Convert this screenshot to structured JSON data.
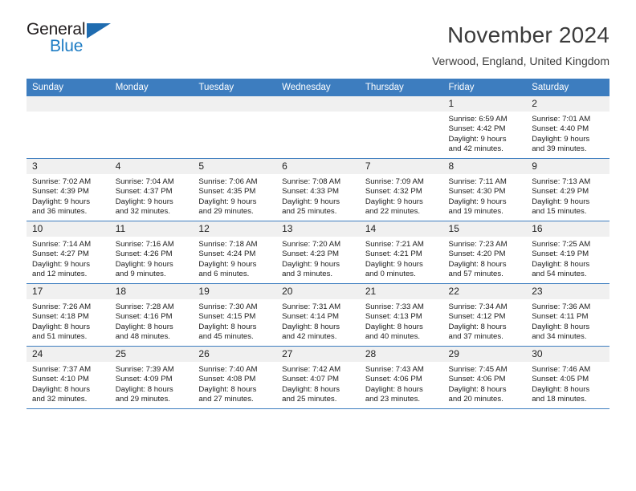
{
  "brand": {
    "name_top": "General",
    "name_bottom": "Blue",
    "triangle_icon": "triangle-icon",
    "accent_color": "#1f6cb0"
  },
  "header": {
    "title": "November 2024",
    "subtitle": "Verwood, England, United Kingdom"
  },
  "calendar": {
    "header_bg": "#3d7dbf",
    "daynum_bg": "#f0f0f0",
    "weekday_headers": [
      "Sunday",
      "Monday",
      "Tuesday",
      "Wednesday",
      "Thursday",
      "Friday",
      "Saturday"
    ],
    "weeks": [
      [
        {
          "day": "",
          "sunrise": "",
          "sunset": "",
          "daylight_line1": "",
          "daylight_line2": ""
        },
        {
          "day": "",
          "sunrise": "",
          "sunset": "",
          "daylight_line1": "",
          "daylight_line2": ""
        },
        {
          "day": "",
          "sunrise": "",
          "sunset": "",
          "daylight_line1": "",
          "daylight_line2": ""
        },
        {
          "day": "",
          "sunrise": "",
          "sunset": "",
          "daylight_line1": "",
          "daylight_line2": ""
        },
        {
          "day": "",
          "sunrise": "",
          "sunset": "",
          "daylight_line1": "",
          "daylight_line2": ""
        },
        {
          "day": "1",
          "sunrise": "Sunrise: 6:59 AM",
          "sunset": "Sunset: 4:42 PM",
          "daylight_line1": "Daylight: 9 hours",
          "daylight_line2": "and 42 minutes."
        },
        {
          "day": "2",
          "sunrise": "Sunrise: 7:01 AM",
          "sunset": "Sunset: 4:40 PM",
          "daylight_line1": "Daylight: 9 hours",
          "daylight_line2": "and 39 minutes."
        }
      ],
      [
        {
          "day": "3",
          "sunrise": "Sunrise: 7:02 AM",
          "sunset": "Sunset: 4:39 PM",
          "daylight_line1": "Daylight: 9 hours",
          "daylight_line2": "and 36 minutes."
        },
        {
          "day": "4",
          "sunrise": "Sunrise: 7:04 AM",
          "sunset": "Sunset: 4:37 PM",
          "daylight_line1": "Daylight: 9 hours",
          "daylight_line2": "and 32 minutes."
        },
        {
          "day": "5",
          "sunrise": "Sunrise: 7:06 AM",
          "sunset": "Sunset: 4:35 PM",
          "daylight_line1": "Daylight: 9 hours",
          "daylight_line2": "and 29 minutes."
        },
        {
          "day": "6",
          "sunrise": "Sunrise: 7:08 AM",
          "sunset": "Sunset: 4:33 PM",
          "daylight_line1": "Daylight: 9 hours",
          "daylight_line2": "and 25 minutes."
        },
        {
          "day": "7",
          "sunrise": "Sunrise: 7:09 AM",
          "sunset": "Sunset: 4:32 PM",
          "daylight_line1": "Daylight: 9 hours",
          "daylight_line2": "and 22 minutes."
        },
        {
          "day": "8",
          "sunrise": "Sunrise: 7:11 AM",
          "sunset": "Sunset: 4:30 PM",
          "daylight_line1": "Daylight: 9 hours",
          "daylight_line2": "and 19 minutes."
        },
        {
          "day": "9",
          "sunrise": "Sunrise: 7:13 AM",
          "sunset": "Sunset: 4:29 PM",
          "daylight_line1": "Daylight: 9 hours",
          "daylight_line2": "and 15 minutes."
        }
      ],
      [
        {
          "day": "10",
          "sunrise": "Sunrise: 7:14 AM",
          "sunset": "Sunset: 4:27 PM",
          "daylight_line1": "Daylight: 9 hours",
          "daylight_line2": "and 12 minutes."
        },
        {
          "day": "11",
          "sunrise": "Sunrise: 7:16 AM",
          "sunset": "Sunset: 4:26 PM",
          "daylight_line1": "Daylight: 9 hours",
          "daylight_line2": "and 9 minutes."
        },
        {
          "day": "12",
          "sunrise": "Sunrise: 7:18 AM",
          "sunset": "Sunset: 4:24 PM",
          "daylight_line1": "Daylight: 9 hours",
          "daylight_line2": "and 6 minutes."
        },
        {
          "day": "13",
          "sunrise": "Sunrise: 7:20 AM",
          "sunset": "Sunset: 4:23 PM",
          "daylight_line1": "Daylight: 9 hours",
          "daylight_line2": "and 3 minutes."
        },
        {
          "day": "14",
          "sunrise": "Sunrise: 7:21 AM",
          "sunset": "Sunset: 4:21 PM",
          "daylight_line1": "Daylight: 9 hours",
          "daylight_line2": "and 0 minutes."
        },
        {
          "day": "15",
          "sunrise": "Sunrise: 7:23 AM",
          "sunset": "Sunset: 4:20 PM",
          "daylight_line1": "Daylight: 8 hours",
          "daylight_line2": "and 57 minutes."
        },
        {
          "day": "16",
          "sunrise": "Sunrise: 7:25 AM",
          "sunset": "Sunset: 4:19 PM",
          "daylight_line1": "Daylight: 8 hours",
          "daylight_line2": "and 54 minutes."
        }
      ],
      [
        {
          "day": "17",
          "sunrise": "Sunrise: 7:26 AM",
          "sunset": "Sunset: 4:18 PM",
          "daylight_line1": "Daylight: 8 hours",
          "daylight_line2": "and 51 minutes."
        },
        {
          "day": "18",
          "sunrise": "Sunrise: 7:28 AM",
          "sunset": "Sunset: 4:16 PM",
          "daylight_line1": "Daylight: 8 hours",
          "daylight_line2": "and 48 minutes."
        },
        {
          "day": "19",
          "sunrise": "Sunrise: 7:30 AM",
          "sunset": "Sunset: 4:15 PM",
          "daylight_line1": "Daylight: 8 hours",
          "daylight_line2": "and 45 minutes."
        },
        {
          "day": "20",
          "sunrise": "Sunrise: 7:31 AM",
          "sunset": "Sunset: 4:14 PM",
          "daylight_line1": "Daylight: 8 hours",
          "daylight_line2": "and 42 minutes."
        },
        {
          "day": "21",
          "sunrise": "Sunrise: 7:33 AM",
          "sunset": "Sunset: 4:13 PM",
          "daylight_line1": "Daylight: 8 hours",
          "daylight_line2": "and 40 minutes."
        },
        {
          "day": "22",
          "sunrise": "Sunrise: 7:34 AM",
          "sunset": "Sunset: 4:12 PM",
          "daylight_line1": "Daylight: 8 hours",
          "daylight_line2": "and 37 minutes."
        },
        {
          "day": "23",
          "sunrise": "Sunrise: 7:36 AM",
          "sunset": "Sunset: 4:11 PM",
          "daylight_line1": "Daylight: 8 hours",
          "daylight_line2": "and 34 minutes."
        }
      ],
      [
        {
          "day": "24",
          "sunrise": "Sunrise: 7:37 AM",
          "sunset": "Sunset: 4:10 PM",
          "daylight_line1": "Daylight: 8 hours",
          "daylight_line2": "and 32 minutes."
        },
        {
          "day": "25",
          "sunrise": "Sunrise: 7:39 AM",
          "sunset": "Sunset: 4:09 PM",
          "daylight_line1": "Daylight: 8 hours",
          "daylight_line2": "and 29 minutes."
        },
        {
          "day": "26",
          "sunrise": "Sunrise: 7:40 AM",
          "sunset": "Sunset: 4:08 PM",
          "daylight_line1": "Daylight: 8 hours",
          "daylight_line2": "and 27 minutes."
        },
        {
          "day": "27",
          "sunrise": "Sunrise: 7:42 AM",
          "sunset": "Sunset: 4:07 PM",
          "daylight_line1": "Daylight: 8 hours",
          "daylight_line2": "and 25 minutes."
        },
        {
          "day": "28",
          "sunrise": "Sunrise: 7:43 AM",
          "sunset": "Sunset: 4:06 PM",
          "daylight_line1": "Daylight: 8 hours",
          "daylight_line2": "and 23 minutes."
        },
        {
          "day": "29",
          "sunrise": "Sunrise: 7:45 AM",
          "sunset": "Sunset: 4:06 PM",
          "daylight_line1": "Daylight: 8 hours",
          "daylight_line2": "and 20 minutes."
        },
        {
          "day": "30",
          "sunrise": "Sunrise: 7:46 AM",
          "sunset": "Sunset: 4:05 PM",
          "daylight_line1": "Daylight: 8 hours",
          "daylight_line2": "and 18 minutes."
        }
      ]
    ]
  }
}
